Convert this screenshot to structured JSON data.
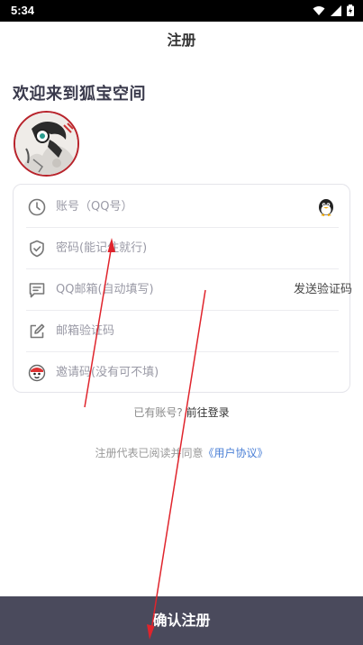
{
  "status_bar": {
    "time": "5:34"
  },
  "nav": {
    "title": "注册"
  },
  "welcome_text": "欢迎来到狐宝空间",
  "form": {
    "account_placeholder": "账号（QQ号）",
    "password_placeholder": "密码(能记住就行)",
    "email_placeholder": "QQ邮箱(自动填写)",
    "send_code_label": "发送验证码",
    "code_placeholder": "邮箱验证码",
    "invite_placeholder": "邀请码(没有可不填)"
  },
  "login_prompt": {
    "text": "已有账号?",
    "link": "前往登录"
  },
  "agreement": {
    "text": "注册代表已阅读并同意",
    "link": "《用户协议》"
  },
  "submit_label": "确认注册",
  "colors": {
    "primary_bar": "#4a4a5c",
    "link_blue": "#4a7fd6",
    "annotation_red": "#e0242c"
  },
  "icons": [
    "clock-icon",
    "shield-icon",
    "message-icon",
    "edit-icon",
    "invite-avatar-icon",
    "qq-penguin-icon"
  ]
}
